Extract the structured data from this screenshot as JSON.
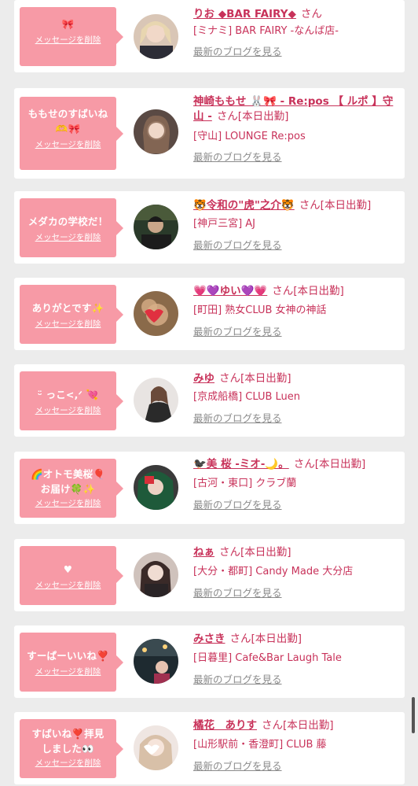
{
  "items": [
    {
      "message": "🎀",
      "delete_label": "メッセージを削除",
      "name": "りお ◆BAR FAIRY◆",
      "suffix": "さん",
      "shop": "[ミナミ] BAR FAIRY -なんば店-",
      "blog_label": "最新のブログを見る"
    },
    {
      "message": "ももせのすばいね🫶🎀",
      "delete_label": "メッセージを削除",
      "name": "神崎ももせ 🐰🎀 - Re:pos 【 ルポ 】守山 -",
      "suffix": "さん[本日出勤]",
      "shop": "[守山] LOUNGE Re:pos",
      "blog_label": "最新のブログを見る"
    },
    {
      "message": "メダカの学校だ！",
      "delete_label": "メッセージを削除",
      "name": "🐯令和の\"虎\"之介🐯",
      "suffix": "さん[本日出勤]",
      "shop": "[神戸三宮] AJ",
      "blog_label": "最新のブログを見る"
    },
    {
      "message": "ありがとです✨",
      "delete_label": "メッセージを削除",
      "name": "💗💜ゆい💜💗",
      "suffix": "さん[本日出勤]",
      "shop": "[町田] 熟女CLUB 女神の神話",
      "blog_label": "最新のブログを見る"
    },
    {
      "message": "ᵕ̈ っこ<,ᐟ 💘",
      "delete_label": "メッセージを削除",
      "name": "みゆ",
      "suffix": "さん[本日出勤]",
      "shop": "[京成船橋] CLUB Luen",
      "blog_label": "最新のブログを見る"
    },
    {
      "message": "🌈オトモ美桜🎈お届け🍀✨",
      "delete_label": "メッセージを削除",
      "name": "🐦‍⬛美 桜 -ミオ-🌙。",
      "suffix": "さん[本日出勤]",
      "shop": "[古河・東口] クラブ蘭",
      "blog_label": "最新のブログを見る"
    },
    {
      "message": "♥",
      "delete_label": "メッセージを削除",
      "name": "ねぁ",
      "suffix": "さん[本日出勤]",
      "shop": "[大分・都町] Candy Made 大分店",
      "blog_label": "最新のブログを見る"
    },
    {
      "message": "すーぱーいいね❣️",
      "delete_label": "メッセージを削除",
      "name": "みさき",
      "suffix": "さん[本日出勤]",
      "shop": "[日暮里] Cafe&Bar Laugh Tale",
      "blog_label": "最新のブログを見る"
    },
    {
      "message": "すばいね❣️拝見しました👀",
      "delete_label": "メッセージを削除",
      "name": "橘花　ありす",
      "suffix": "さん[本日出勤]",
      "shop": "[山形駅前・香澄町] CLUB 藤",
      "blog_label": "最新のブログを見る"
    }
  ],
  "colors": {
    "accent": "#c8325a",
    "bubble": "#f79aa6",
    "background": "#ececec",
    "link_gray": "#8a8a8a"
  }
}
